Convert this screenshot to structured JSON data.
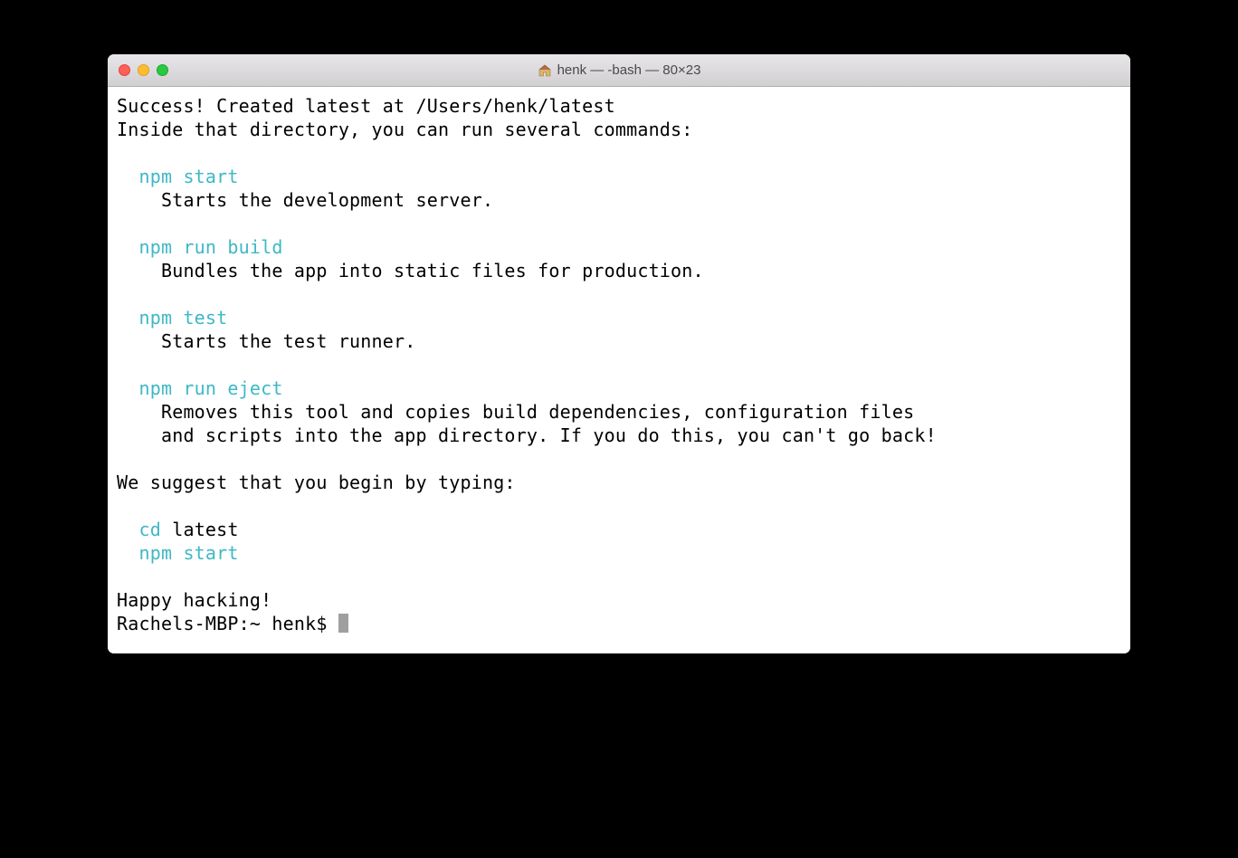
{
  "window": {
    "title": "henk — -bash — 80×23",
    "icon": "home-icon"
  },
  "terminal": {
    "line1": "Success! Created latest at /Users/henk/latest",
    "line2": "Inside that directory, you can run several commands:",
    "cmd1": "  npm start",
    "desc1": "    Starts the development server.",
    "cmd2": "  npm run build",
    "desc2": "    Bundles the app into static files for production.",
    "cmd3": "  npm test",
    "desc3": "    Starts the test runner.",
    "cmd4": "  npm run eject",
    "desc4a": "    Removes this tool and copies build dependencies, configuration files",
    "desc4b": "    and scripts into the app directory. If you do this, you can't go back!",
    "suggest": "We suggest that you begin by typing:",
    "sugCmd1a": "  cd",
    "sugCmd1b": " latest",
    "sugCmd2": "  npm start",
    "happy": "Happy hacking!",
    "prompt": "Rachels-MBP:~ henk$ "
  }
}
